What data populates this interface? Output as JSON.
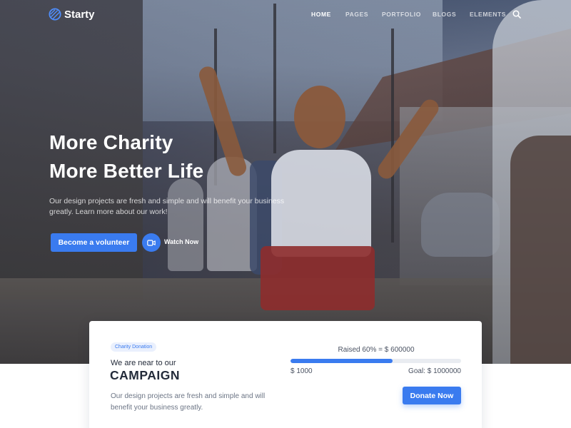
{
  "brand": {
    "name": "Starty",
    "icon": "globe-logo-icon"
  },
  "nav": {
    "items": [
      {
        "label": "HOME",
        "active": true
      },
      {
        "label": "PAGES",
        "active": false
      },
      {
        "label": "PORTFOLIO",
        "active": false
      },
      {
        "label": "BLOGS",
        "active": false
      },
      {
        "label": "ELEMENTS",
        "active": false
      }
    ],
    "search_icon": "search-icon"
  },
  "hero": {
    "title_line1": "More Charity",
    "title_line2": "More Better Life",
    "description": "Our design projects are fresh and simple and will benefit your business greatly. Learn more about our work!",
    "primary_button": "Become a volunteer",
    "watch_label": "Watch Now",
    "watch_icon": "video-camera-icon"
  },
  "campaign": {
    "badge": "Charity Donation",
    "subtitle": "We are near to our",
    "title": "CAMPAIGN",
    "description": "Our design projects are fresh and simple and will benefit your business greatly.",
    "raised_text": "Raised 60% = $ 600000",
    "progress": 0.6,
    "current_amount": "$ 1000",
    "goal_text": "Goal: $ 1000000",
    "donate_button": "Donate Now"
  },
  "colors": {
    "accent": "#3a7bef",
    "heading": "#232b3a",
    "body_text": "#6c7585"
  }
}
